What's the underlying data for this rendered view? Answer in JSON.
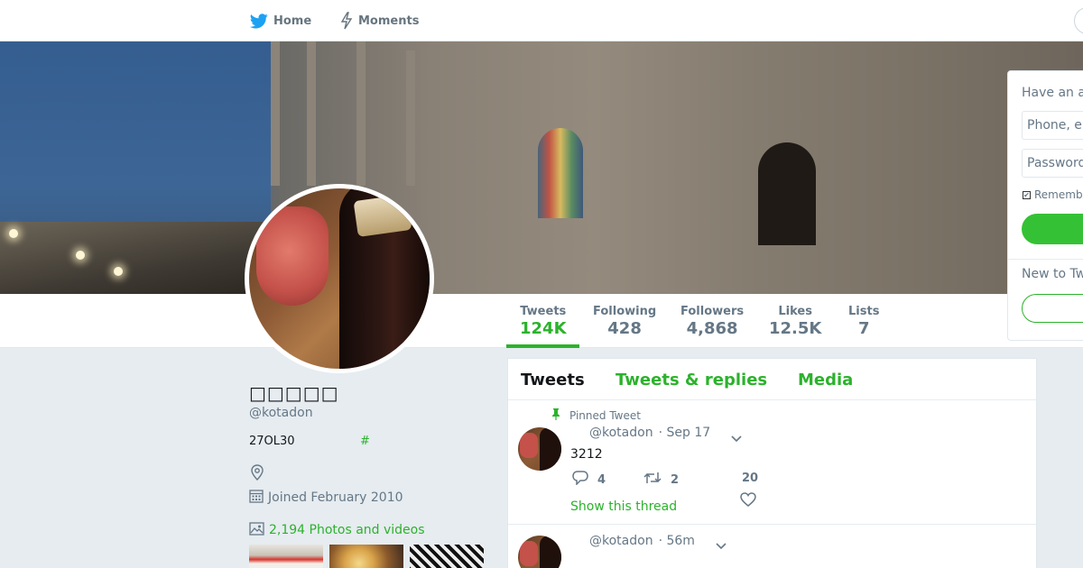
{
  "nav": {
    "home_label": "Home",
    "moments_label": "Moments"
  },
  "colors": {
    "accent": "#2cb22c",
    "nav_bird": "#1da1f2",
    "muted": "#657786"
  },
  "profile": {
    "name": "□□□□□",
    "handle": "@kotadon",
    "bio": "27OL30",
    "bio_hashtag": "#",
    "joined": "Joined February 2010",
    "photos_label": "2,194 Photos and videos"
  },
  "stats": [
    {
      "label": "Tweets",
      "value": "124K"
    },
    {
      "label": "Following",
      "value": "428"
    },
    {
      "label": "Followers",
      "value": "4,868"
    },
    {
      "label": "Likes",
      "value": "12.5K"
    },
    {
      "label": "Lists",
      "value": "7"
    }
  ],
  "tabs": {
    "tweets": "Tweets",
    "replies": "Tweets & replies",
    "media": "Media"
  },
  "tweets": [
    {
      "pinned_label": "Pinned Tweet",
      "handle": "@kotadon",
      "time": "· Sep 17",
      "text": "3212",
      "replies": "4",
      "retweets": "2",
      "likes": "20",
      "thread_label": "Show this thread"
    },
    {
      "handle": "@kotadon",
      "time": "· 56m"
    }
  ],
  "login": {
    "title": "Have an a",
    "phone_placeholder": "Phone, er",
    "password_placeholder": "Password",
    "remember_label": "Remembe",
    "new_to": "New to Tw"
  }
}
